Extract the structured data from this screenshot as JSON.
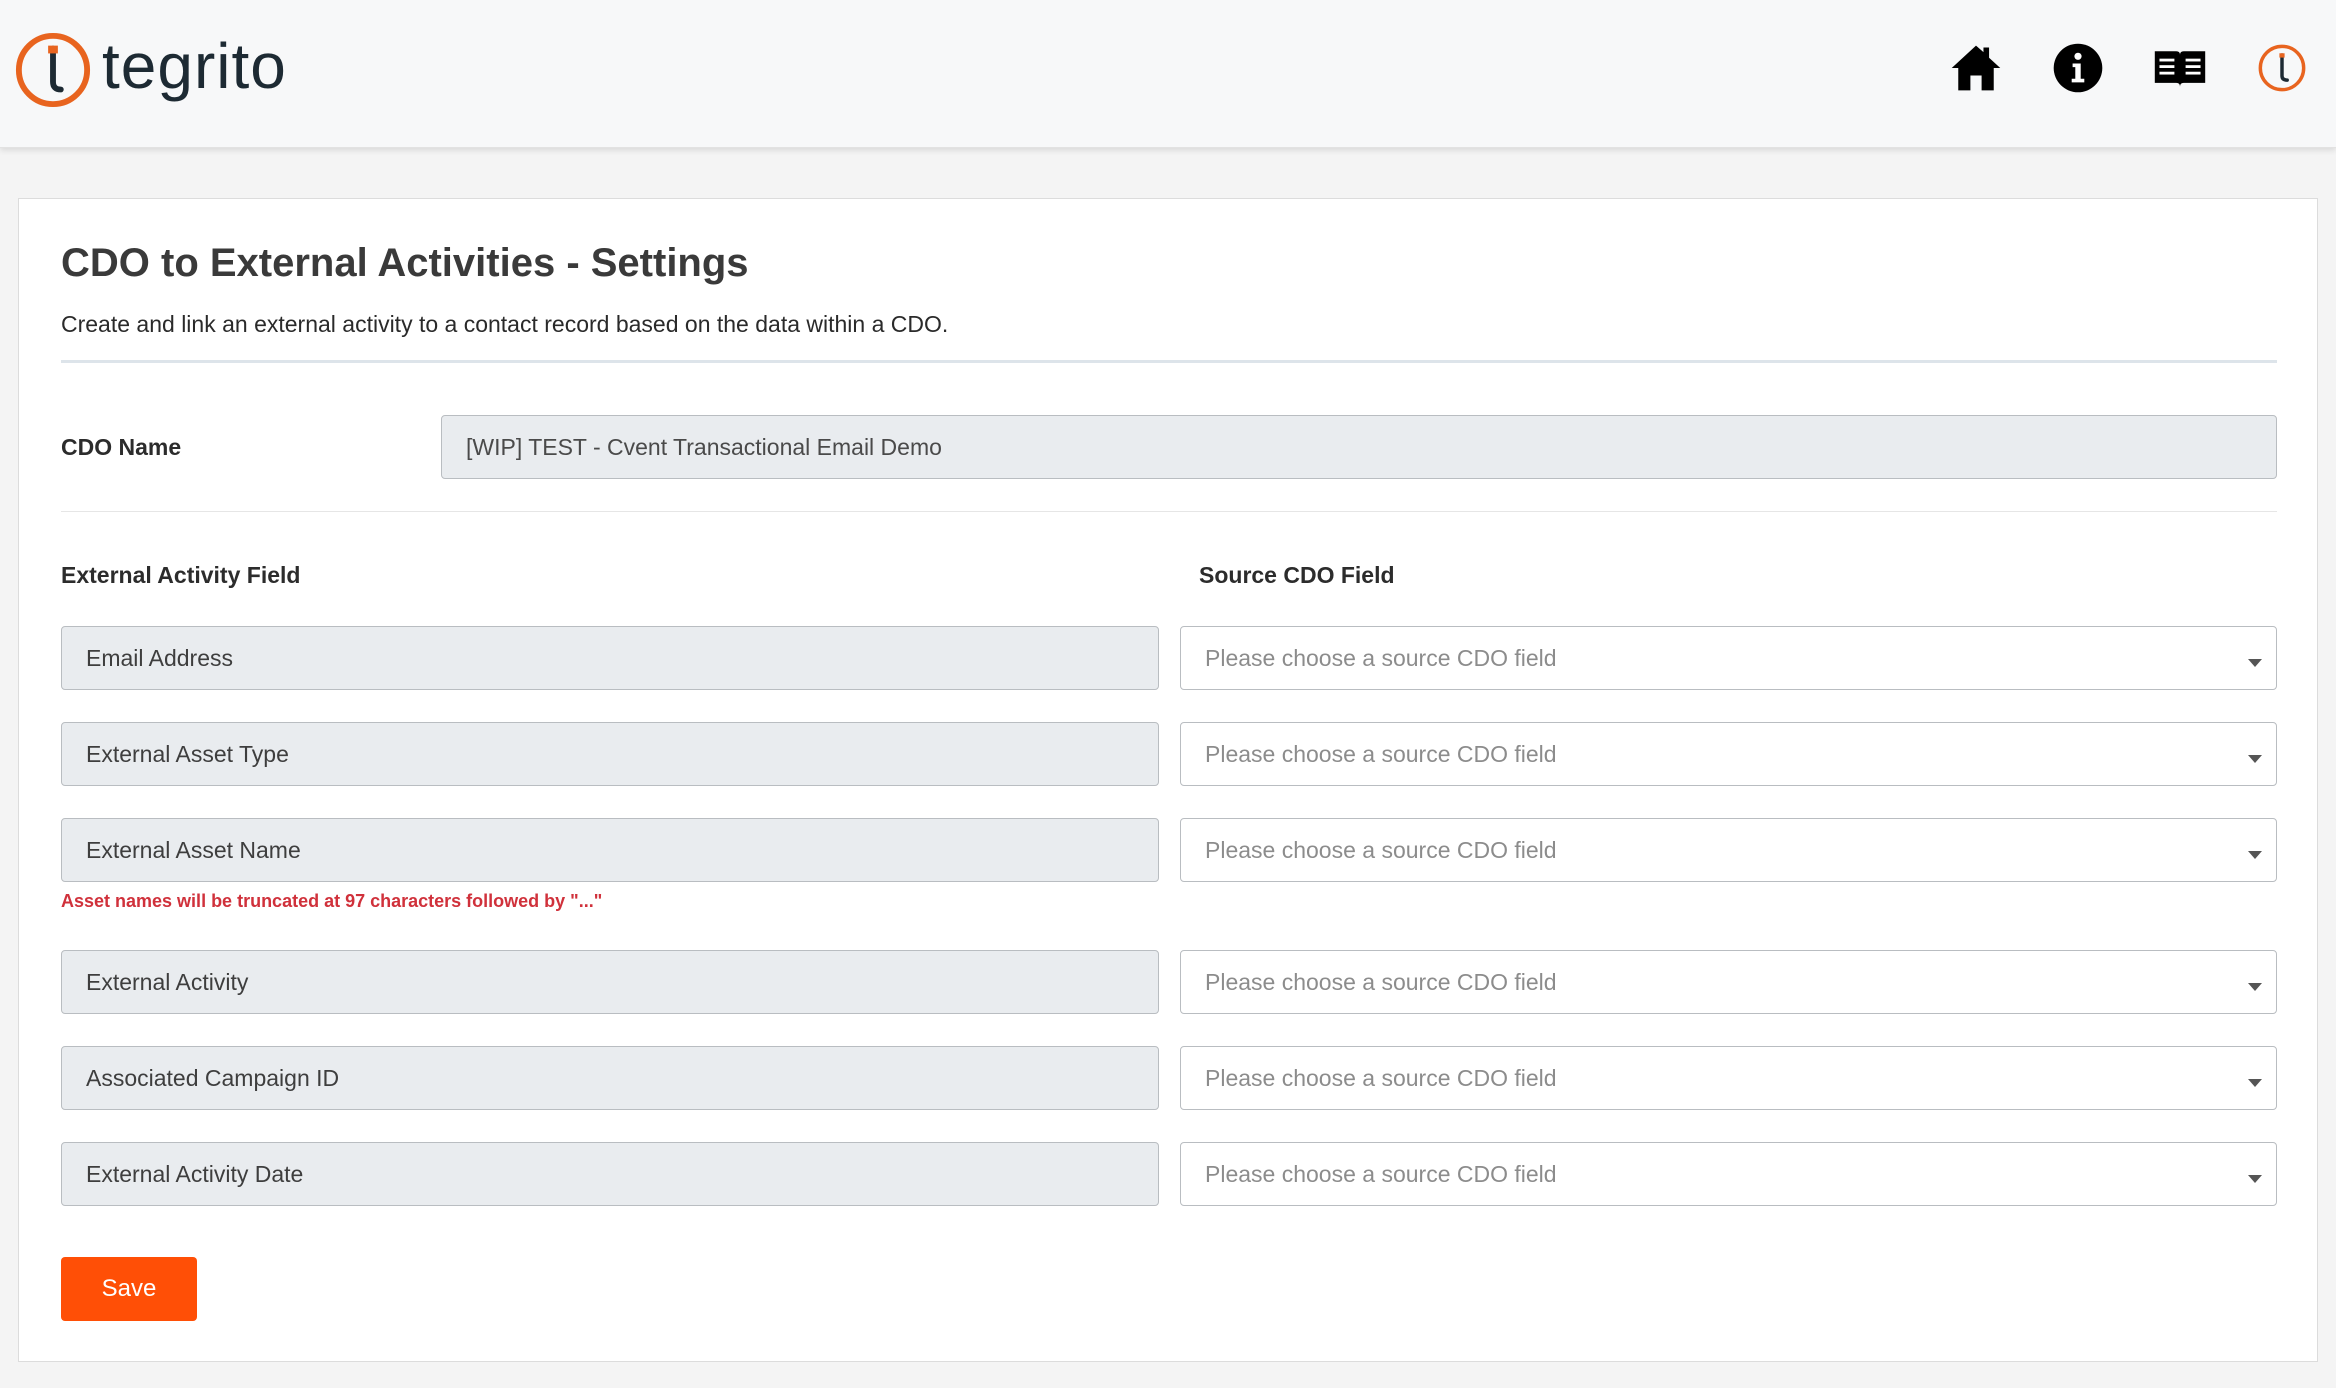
{
  "header": {
    "logo_text_main": "tegrit",
    "logo_text_tail": "o",
    "icons": [
      "home-icon",
      "info-icon",
      "book-icon",
      "tegrito-icon"
    ],
    "brand_color": "#e8641f"
  },
  "page": {
    "title": "CDO to External Activities - Settings",
    "description": "Create and link an external activity to a contact record based on the data within a CDO."
  },
  "cdo": {
    "label": "CDO Name",
    "value": "[WIP] TEST - Cvent Transactional Email Demo"
  },
  "mapping": {
    "left_header": "External Activity Field",
    "right_header": "Source CDO Field",
    "placeholder": "Please choose a source CDO field",
    "warning": "Asset names will be truncated at 97 characters followed by \"...\"",
    "rows": [
      {
        "field": "Email Address"
      },
      {
        "field": "External Asset Type"
      },
      {
        "field": "External Asset Name"
      },
      {
        "field": "External Activity"
      },
      {
        "field": "Associated Campaign ID"
      },
      {
        "field": "External Activity Date"
      }
    ]
  },
  "actions": {
    "save_label": "Save",
    "save_color": "#ff4f06"
  }
}
